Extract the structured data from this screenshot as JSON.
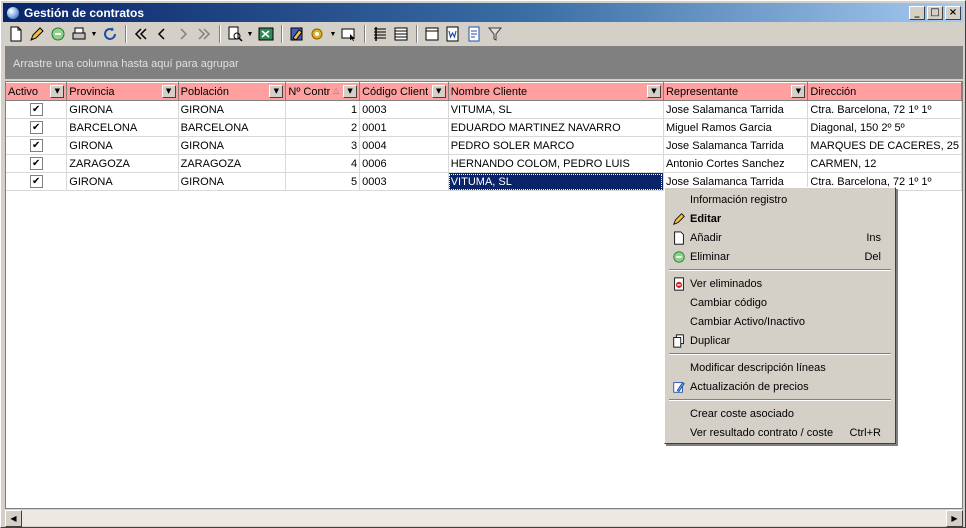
{
  "window": {
    "title": "Gestión de contratos"
  },
  "groupbar": {
    "hint": "Arrastre una columna hasta aquí para agrupar"
  },
  "grid": {
    "columns": [
      "Activo",
      "Provincia",
      "Población",
      "Nº Contr",
      "Código Cliente",
      "Nombre Cliente",
      "Representante",
      "Dirección"
    ],
    "rows": [
      {
        "activo": "✔",
        "provincia": "GIRONA",
        "poblacion": "GIRONA",
        "contrato": "1",
        "codigo": "0003",
        "nombre": "VITUMA, SL",
        "representante": "Jose Salamanca Tarrida",
        "direccion": "Ctra. Barcelona, 72 1º 1º"
      },
      {
        "activo": "✔",
        "provincia": "BARCELONA",
        "poblacion": "BARCELONA",
        "contrato": "2",
        "codigo": "0001",
        "nombre": "EDUARDO MARTINEZ NAVARRO",
        "representante": "Miguel Ramos Garcia",
        "direccion": "Diagonal, 150 2º 5º"
      },
      {
        "activo": "✔",
        "provincia": "GIRONA",
        "poblacion": "GIRONA",
        "contrato": "3",
        "codigo": "0004",
        "nombre": "PEDRO SOLER MARCO",
        "representante": "Jose Salamanca Tarrida",
        "direccion": "MARQUES DE CACERES, 25"
      },
      {
        "activo": "✔",
        "provincia": "ZARAGOZA",
        "poblacion": "ZARAGOZA",
        "contrato": "4",
        "codigo": "0006",
        "nombre": "HERNANDO COLOM, PEDRO LUIS",
        "representante": "Antonio Cortes Sanchez",
        "direccion": "CARMEN, 12"
      },
      {
        "activo": "✔",
        "provincia": "GIRONA",
        "poblacion": "GIRONA",
        "contrato": "5",
        "codigo": "0003",
        "nombre": "VITUMA, SL",
        "representante": "Jose Salamanca Tarrida",
        "direccion": "Ctra. Barcelona, 72 1º 1º"
      }
    ]
  },
  "contextmenu": {
    "items": [
      {
        "label": "Información registro",
        "shortcut": "",
        "icon": ""
      },
      {
        "label": "Editar",
        "shortcut": "",
        "icon": "edit-icon"
      },
      {
        "label": "Añadir",
        "shortcut": "Ins",
        "icon": "new-document-icon"
      },
      {
        "label": "Eliminar",
        "shortcut": "Del",
        "icon": "recycle-icon"
      },
      {
        "label": "Ver eliminados",
        "shortcut": "",
        "icon": "deleted-view-icon"
      },
      {
        "label": "Cambiar código",
        "shortcut": "",
        "icon": ""
      },
      {
        "label": "Cambiar Activo/Inactivo",
        "shortcut": "",
        "icon": ""
      },
      {
        "label": "Duplicar",
        "shortcut": "",
        "icon": "copy-icon"
      },
      {
        "label": "Modificar descripción líneas",
        "shortcut": "",
        "icon": ""
      },
      {
        "label": "Actualización de precios",
        "shortcut": "",
        "icon": "price-update-icon"
      },
      {
        "label": "Crear coste asociado",
        "shortcut": "",
        "icon": ""
      },
      {
        "label": "Ver resultado contrato / coste",
        "shortcut": "Ctrl+R",
        "icon": ""
      }
    ]
  },
  "toolbar": {
    "icons": [
      "new-icon",
      "edit-icon",
      "delete-icon",
      "print-icon",
      "refresh-icon",
      "first-icon",
      "previous-icon",
      "next-icon",
      "last-icon",
      "preview-icon",
      "export-excel-icon",
      "report-icon",
      "tools-icon",
      "select-icon",
      "columns-icon",
      "rows-icon",
      "form-icon",
      "word-icon",
      "document-icon",
      "filter-icon"
    ]
  },
  "colors": {
    "header_bg": "#ffa0a0",
    "selection_bg": "#0a246a",
    "titlebar": "#0a246a"
  }
}
